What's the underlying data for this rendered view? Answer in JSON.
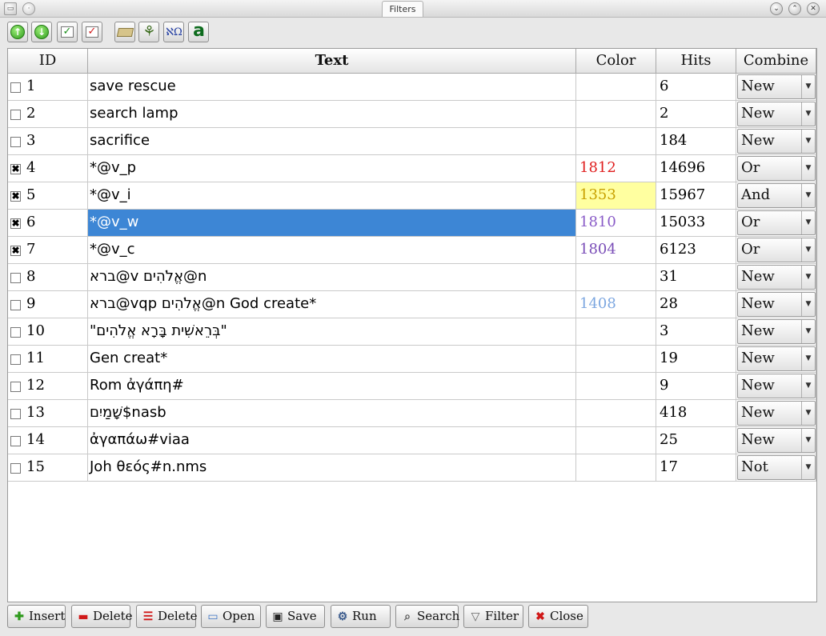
{
  "window": {
    "title": "Filters"
  },
  "colors": {
    "selection": "#3d86d5",
    "highlight": "#ffffa0"
  },
  "toolbar": {
    "icons": [
      "move-up-icon",
      "move-down-icon",
      "check-all-icon",
      "uncheck-all-icon",
      "book-icon",
      "tree-icon",
      "alef-omega-icon",
      "letter-a-icon"
    ],
    "letter_a": "a",
    "alef_omega": "ℵΩ"
  },
  "table": {
    "headers": {
      "id": "ID",
      "text": "Text",
      "color": "Color",
      "hits": "Hits",
      "combine": "Combine"
    },
    "rows": [
      {
        "checked": false,
        "id": "1",
        "text": "save rescue",
        "color": "",
        "color_hex": "",
        "hits": "6",
        "combine": "New"
      },
      {
        "checked": false,
        "id": "2",
        "text": "search lamp",
        "color": "",
        "color_hex": "",
        "hits": "2",
        "combine": "New"
      },
      {
        "checked": false,
        "id": "3",
        "text": "sacrifice",
        "color": "",
        "color_hex": "",
        "hits": "184",
        "combine": "New"
      },
      {
        "checked": true,
        "id": "4",
        "text": "*@v_p",
        "color": "1812",
        "color_hex": "#e02020",
        "hits": "14696",
        "combine": "Or"
      },
      {
        "checked": true,
        "id": "5",
        "text": "*@v_i",
        "color": "1353",
        "color_hex": "#c8a000",
        "hits": "15967",
        "combine": "And"
      },
      {
        "checked": true,
        "id": "6",
        "text": "*@v_w",
        "color": "1810",
        "color_hex": "#8a5cc8",
        "hits": "15033",
        "combine": "Or"
      },
      {
        "checked": true,
        "id": "7",
        "text": "*@v_c",
        "color": "1804",
        "color_hex": "#7b4fb8",
        "hits": "6123",
        "combine": "Or"
      },
      {
        "checked": false,
        "id": "8",
        "text": "ברא@v אֱלֹהִים@n",
        "color": "",
        "color_hex": "",
        "hits": "31",
        "combine": "New"
      },
      {
        "checked": false,
        "id": "9",
        "text": "ברא@vqp אֱלֹהִים@n God create*",
        "color": "1408",
        "color_hex": "#7da7e0",
        "hits": "28",
        "combine": "New"
      },
      {
        "checked": false,
        "id": "10",
        "text": "\"בְּרֵאשִׁית בָּרָא אֱלֹהִים\"",
        "color": "",
        "color_hex": "",
        "hits": "3",
        "combine": "New"
      },
      {
        "checked": false,
        "id": "11",
        "text": "Gen creat*",
        "color": "",
        "color_hex": "",
        "hits": "19",
        "combine": "New"
      },
      {
        "checked": false,
        "id": "12",
        "text": "Rom ἀγάπη#",
        "color": "",
        "color_hex": "",
        "hits": "9",
        "combine": "New"
      },
      {
        "checked": false,
        "id": "13",
        "text": "שָׁמַיִם$nasb",
        "color": "",
        "color_hex": "",
        "hits": "418",
        "combine": "New"
      },
      {
        "checked": false,
        "id": "14",
        "text": "ἀγαπάω#viaa",
        "color": "",
        "color_hex": "",
        "hits": "25",
        "combine": "New"
      },
      {
        "checked": false,
        "id": "15",
        "text": "Joh θεός#n.nms",
        "color": "",
        "color_hex": "",
        "hits": "17",
        "combine": "Not"
      }
    ]
  },
  "buttons": {
    "insert": "Insert",
    "delete1": "Delete",
    "delete2": "Delete",
    "open": "Open",
    "save": "Save",
    "run": "Run",
    "search": "Search",
    "filter": "Filter",
    "close": "Close"
  }
}
